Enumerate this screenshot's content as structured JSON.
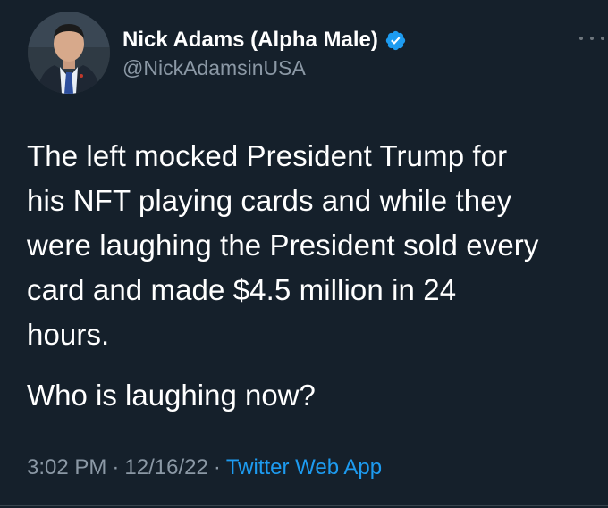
{
  "tweet": {
    "author": {
      "display_name": "Nick Adams (Alpha Male)",
      "handle": "@NickAdamsinUSA",
      "verified": true
    },
    "text_lines": [
      "The left mocked President Trump for",
      "his NFT playing cards and while they",
      "were laughing the President sold every",
      "card and made $4.5 million in 24",
      "hours."
    ],
    "text_second": "Who is laughing now?",
    "meta": {
      "time": "3:02 PM",
      "separator": "·",
      "date": "12/16/22",
      "source": "Twitter Web App"
    }
  },
  "icons": {
    "verified": "verified-badge-icon",
    "more": "more-options-icon"
  },
  "colors": {
    "background": "#15202b",
    "text": "#ffffff",
    "secondary": "#8b98a5",
    "accent": "#1d9bf0"
  }
}
